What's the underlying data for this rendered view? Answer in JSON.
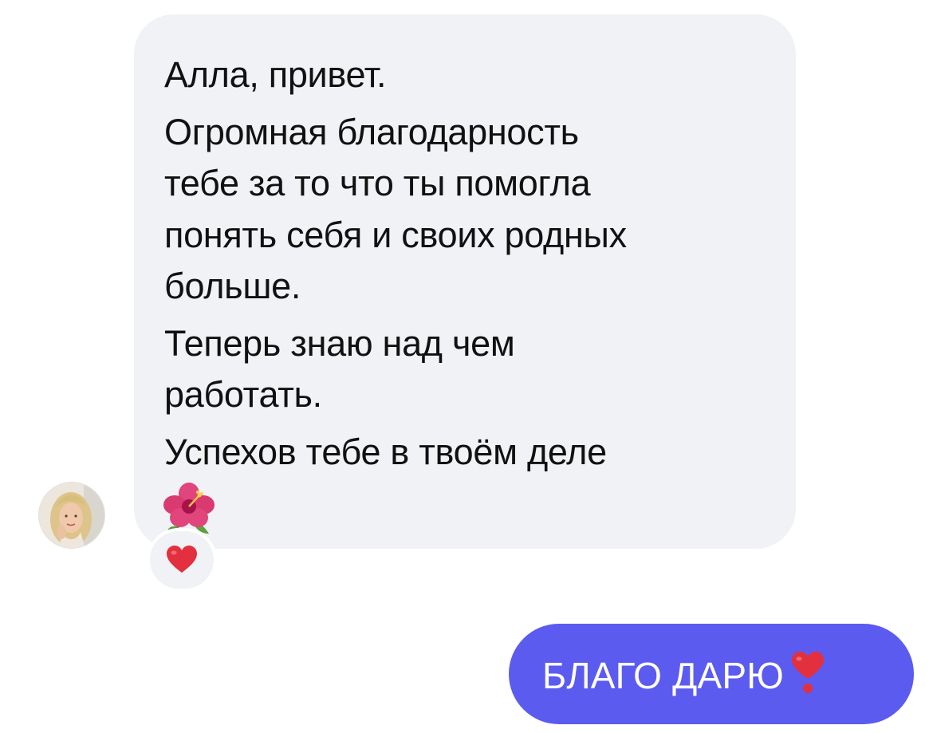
{
  "incoming": {
    "lines": [
      "Алла, привет.",
      "Огромная благодарность",
      "тебе за то что ты помогла",
      "понять себя и своих родных",
      "больше.",
      "Теперь знаю над чем",
      "работать.",
      "Успехов тебе в твоём деле"
    ],
    "trailing_emoji": "hibiscus",
    "reaction": "red-heart",
    "bubble_color": "#f1f2f6"
  },
  "outgoing": {
    "text": "БЛАГО ДАРЮ",
    "trailing_emoji": "heavy-heart-exclamation",
    "bubble_color": "#5b5bf0"
  }
}
